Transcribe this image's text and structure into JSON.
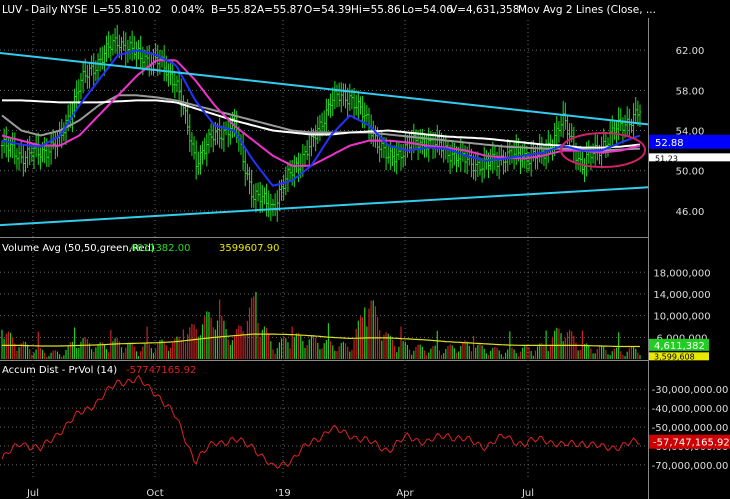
{
  "header": {
    "symbol": "LUV",
    "interval": "Daily",
    "exchange": "NYSE",
    "last": "L=55.81",
    "change": "0.02",
    "change_pct": "0.04%",
    "bid": "B=55.82",
    "ask": "A=55.87",
    "open": "O=54.39",
    "high": "Hi=55.86",
    "low": "Lo=54.06",
    "volume": "V=4,631,358",
    "study": "Mov Avg 2 Lines (Close, ..."
  },
  "colors": {
    "background": "#000000",
    "candles": "#22dd22",
    "trendline": "#33ccee",
    "ma_blue": "#2233ff",
    "ma_magenta": "#ee33cc",
    "ma_white": "#ffffff",
    "ma_gray": "#9a9a9a",
    "volume_up": "#22cc22",
    "volume_down": "#cc2222",
    "volume_avg": "#e0e020",
    "accum": "#dd2222",
    "ellipse": "#cc2266",
    "price_badge_blue": "#0000ff",
    "price_badge_white": "#ffffff",
    "vol_badge_green": "#22cc22",
    "vol_badge_yellow": "#e8e800",
    "accum_badge_red": "#cc0000"
  },
  "chart_data": [
    {
      "type": "line",
      "name": "price",
      "x": [
        "Jun 18",
        "Jul 2",
        "Jul 16",
        "Jul 30",
        "Aug 13",
        "Aug 27",
        "Sep 10",
        "Sep 24",
        "Oct 8",
        "Oct 22",
        "Nov 5",
        "Nov 19",
        "Dec 3",
        "Dec 17",
        "Jan 2",
        "Jan 14",
        "Jan 28",
        "Feb 11",
        "Feb 25",
        "Mar 11",
        "Mar 25",
        "Apr 8",
        "Apr 22",
        "May 6",
        "May 20",
        "Jun 3",
        "Jun 17",
        "Jul 1",
        "Jul 15",
        "Jul 29",
        "Aug 12",
        "Aug 26",
        "Sep 9",
        "Sep 16"
      ],
      "close": [
        52.5,
        51.5,
        51.8,
        53.0,
        58.5,
        61.0,
        63.0,
        61.5,
        61.0,
        59.0,
        51.0,
        53.5,
        54.5,
        47.5,
        46.5,
        50.0,
        52.5,
        57.0,
        57.5,
        54.5,
        51.0,
        52.5,
        53.0,
        52.0,
        51.0,
        50.5,
        51.5,
        51.5,
        51.5,
        55.0,
        50.5,
        52.5,
        54.5,
        55.81
      ],
      "ma_blue": [
        53.0,
        52.6,
        52.4,
        53.5,
        56.5,
        59.0,
        61.5,
        62.0,
        61.5,
        60.5,
        57.0,
        54.5,
        54.0,
        51.0,
        48.5,
        49.0,
        50.5,
        53.5,
        55.5,
        54.5,
        52.5,
        52.0,
        52.3,
        52.2,
        51.5,
        51.0,
        51.2,
        51.5,
        51.8,
        52.5,
        52.0,
        52.0,
        52.8,
        53.5
      ],
      "ma_magenta": [
        53.5,
        53.0,
        52.5,
        52.5,
        53.5,
        55.5,
        57.5,
        59.5,
        61.0,
        61.0,
        59.0,
        56.5,
        54.5,
        53.0,
        51.5,
        50.5,
        50.5,
        51.5,
        52.5,
        53.0,
        53.0,
        52.8,
        52.5,
        52.3,
        52.0,
        51.5,
        51.3,
        51.2,
        51.5,
        52.0,
        52.0,
        51.8,
        52.0,
        52.5
      ],
      "ma_white": [
        57.0,
        57.0,
        56.9,
        56.8,
        56.8,
        56.8,
        56.9,
        57.0,
        57.0,
        56.8,
        56.2,
        55.6,
        55.0,
        54.5,
        54.0,
        53.8,
        53.6,
        53.6,
        53.8,
        53.9,
        54.0,
        53.8,
        53.6,
        53.4,
        53.3,
        53.2,
        53.0,
        52.8,
        52.6,
        52.5,
        52.3,
        52.3,
        52.4,
        52.6
      ],
      "ma_gray": [
        55.5,
        54.0,
        53.5,
        54.0,
        55.0,
        56.5,
        57.5,
        57.5,
        57.3,
        57.0,
        56.5,
        56.0,
        55.5,
        55.0,
        54.5,
        54.0,
        53.8,
        53.8,
        53.8,
        53.8,
        53.6,
        53.4,
        53.2,
        53.0,
        52.8,
        52.6,
        52.4,
        52.3,
        52.2,
        52.2,
        52.1,
        52.0,
        52.1,
        52.2
      ],
      "ylim": [
        43.5,
        65.0
      ],
      "yticks": [
        "62.00",
        "58.00",
        "54.00",
        "50.00",
        "46.00"
      ],
      "xticks": [
        "Jul",
        "Oct",
        "'19",
        "Apr",
        "Jul"
      ],
      "trendlines": [
        {
          "from": [
            "Jun 18",
            61.7
          ],
          "to": [
            "Sep 16",
            54.7
          ]
        },
        {
          "from": [
            "Jun 18",
            44.6
          ],
          "to": [
            "Sep 16",
            48.3
          ]
        }
      ],
      "badges": [
        "52.88",
        "51.23"
      ]
    },
    {
      "type": "bar",
      "name": "volume",
      "label": "Volume Avg (50,50,green,Red)",
      "values_label": [
        "4611382.00",
        "3599607.90"
      ],
      "values": [
        8.0,
        5.5,
        4.0,
        3.5,
        6.5,
        5.0,
        6.0,
        4.5,
        5.5,
        6.0,
        9.0,
        12.0,
        6.5,
        14.0,
        5.0,
        7.0,
        6.5,
        5.5,
        5.0,
        14.5,
        6.5,
        5.0,
        4.5,
        4.5,
        5.5,
        4.5,
        4.0,
        4.5,
        5.0,
        9.0,
        5.0,
        4.5,
        4.0,
        4.6
      ],
      "average": [
        4.5,
        4.5,
        4.4,
        4.4,
        4.5,
        4.6,
        4.8,
        4.9,
        5.0,
        5.2,
        5.6,
        6.0,
        6.3,
        6.6,
        6.6,
        6.5,
        6.3,
        6.0,
        5.8,
        5.9,
        5.9,
        5.7,
        5.5,
        5.2,
        5.0,
        4.8,
        4.6,
        4.5,
        4.5,
        4.5,
        4.5,
        4.4,
        4.3,
        4.3
      ],
      "ylim": [
        2,
        21
      ],
      "yticks": [
        "18,000,000",
        "14,000,000",
        "10,000,000",
        "6,000,000"
      ],
      "badges": [
        "4,611,382",
        "3,599,608"
      ]
    },
    {
      "type": "line",
      "name": "accum_dist",
      "label": "Accum Dist - PrVol (14)",
      "value_label": "-57747165.92",
      "values": [
        -67,
        -58,
        -62,
        -52,
        -43,
        -36,
        -26,
        -25,
        -32,
        -45,
        -68,
        -58,
        -57,
        -60,
        -72,
        -67,
        -58,
        -51,
        -54,
        -58,
        -62,
        -55,
        -58,
        -54,
        -57,
        -60,
        -55,
        -59,
        -56,
        -60,
        -58,
        -61,
        -60,
        -57.7
      ],
      "ylim": [
        -78,
        -23
      ],
      "yticks": [
        "-30,000,000.00",
        "-40,000,000.00",
        "-50,000,000.00",
        "-60,000,000.00",
        "-70,000,000.00"
      ],
      "badge": "-57,747,165.92"
    }
  ]
}
